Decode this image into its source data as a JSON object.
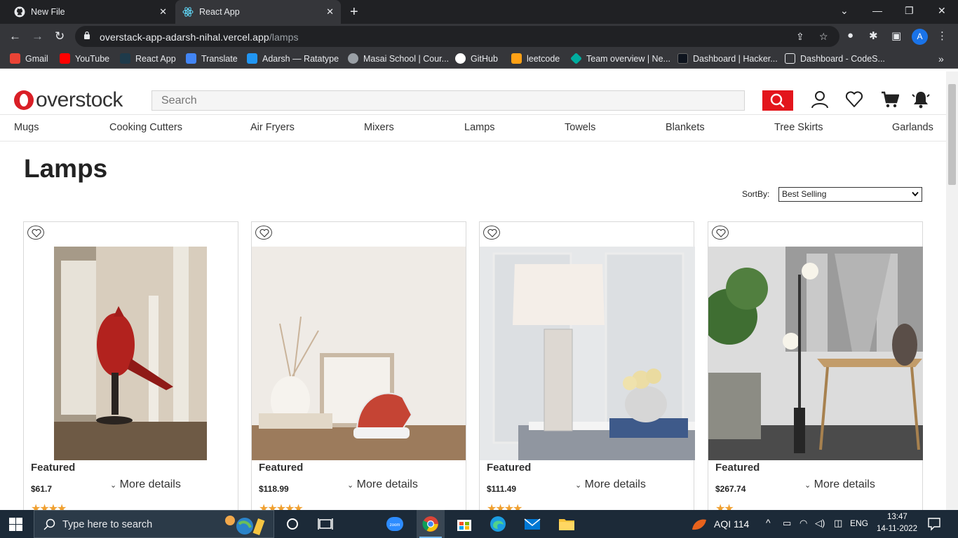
{
  "browser": {
    "tabs": [
      {
        "title": "New File",
        "active": false
      },
      {
        "title": "React App",
        "active": true
      }
    ],
    "url_host": "overstack-app-adarsh-nihal.vercel.app",
    "url_path": "/lamps",
    "profile_initial": "A",
    "bookmarks": [
      {
        "label": "Gmail",
        "icon": "gmail-icon",
        "color": "#ea4335"
      },
      {
        "label": "YouTube",
        "icon": "youtube-icon",
        "color": "#ff0000"
      },
      {
        "label": "React App",
        "icon": "react-icon",
        "color": "#61dafb"
      },
      {
        "label": "Translate",
        "icon": "translate-icon",
        "color": "#4285f4"
      },
      {
        "label": "Adarsh — Ratatype",
        "icon": "ratatype-icon",
        "color": "#2196f3"
      },
      {
        "label": "Masai School | Cour...",
        "icon": "globe-icon",
        "color": "#9aa0a6"
      },
      {
        "label": "GitHub",
        "icon": "github-icon",
        "color": "#ffffff"
      },
      {
        "label": "leetcode",
        "icon": "leetcode-icon",
        "color": "#ffa116"
      },
      {
        "label": "Team overview | Ne...",
        "icon": "diamond-icon",
        "color": "#00ad9f"
      },
      {
        "label": "Dashboard | Hacker...",
        "icon": "hackerrank-icon",
        "color": "#0e141e"
      },
      {
        "label": "Dashboard - CodeS...",
        "icon": "page-icon",
        "color": "#9aa0a6"
      }
    ]
  },
  "site": {
    "logo_text": "overstock",
    "search_placeholder": "Search",
    "categories": [
      "Mugs",
      "Cooking Cutters",
      "Air Fryers",
      "Mixers",
      "Lamps",
      "Towels",
      "Blankets",
      "Tree Skirts",
      "Garlands"
    ],
    "page_title": "Lamps",
    "sort_label": "SortBy:",
    "sort_value": "Best Selling",
    "products": [
      {
        "badge": "Featured",
        "price": "$61.7",
        "more": "More details",
        "rating": 4
      },
      {
        "badge": "Featured",
        "price": "$118.99",
        "more": "More details",
        "rating": 5
      },
      {
        "badge": "Featured",
        "price": "$111.49",
        "more": "More details",
        "rating": 4
      },
      {
        "badge": "Featured",
        "price": "$267.74",
        "more": "More details",
        "rating": 2
      }
    ],
    "accent_color": "#e3151c"
  },
  "taskbar": {
    "search_placeholder": "Type here to search",
    "aqi": "AQI 114",
    "language": "ENG",
    "time": "13:47",
    "date": "14-11-2022"
  }
}
